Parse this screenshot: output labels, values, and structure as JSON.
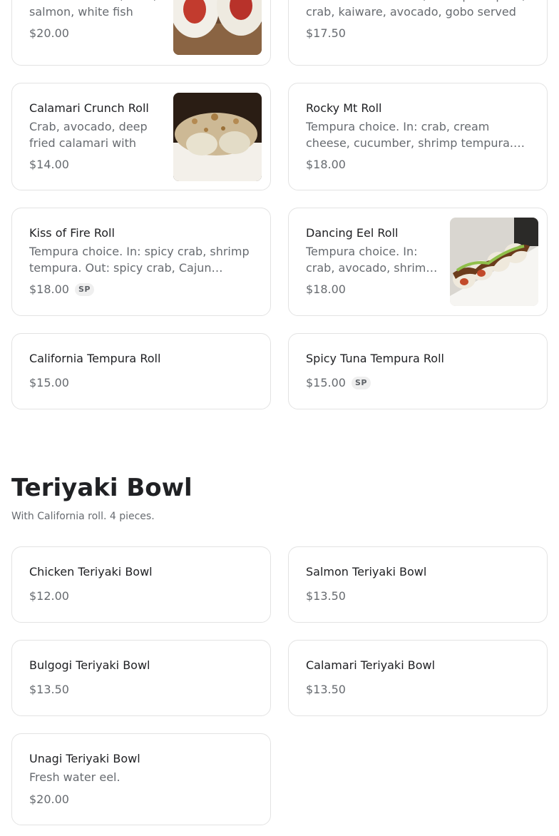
{
  "sushi_rolls": {
    "items": [
      {
        "name": "",
        "desc": "No rice. In: crab, tuna, salmon, white fish",
        "price": "$20.00",
        "image": "sushi-roll-photo"
      },
      {
        "name": "",
        "desc": "No rice. Seared tuna, shrimp tempura, crab, kaiware, avocado, gobo served",
        "price": "$17.50"
      },
      {
        "name": "Calamari Crunch Roll",
        "desc": "Crab, avocado, deep fried calamari with",
        "price": "$14.00",
        "image": "calamari-crunch-photo"
      },
      {
        "name": "Rocky Mt Roll",
        "desc": "Tempura choice. In: crab, cream cheese, cucumber, shrimp tempura. Out:",
        "price": "$18.00"
      },
      {
        "name": "Kiss of Fire Roll",
        "desc": "Tempura choice. In: spicy crab, shrimp tempura. Out: spicy crab, Cajun seasoning",
        "price": "$18.00",
        "badge": "SP"
      },
      {
        "name": "Dancing Eel Roll",
        "desc": "Tempura choice. In: crab, avocado, shrimp tempura",
        "price": "$18.00",
        "image": "dancing-eel-photo"
      },
      {
        "name": "California Tempura Roll",
        "price": "$15.00"
      },
      {
        "name": "Spicy Tuna Tempura Roll",
        "price": "$15.00",
        "badge": "SP"
      }
    ]
  },
  "teriyaki_bowl": {
    "title": "Teriyaki Bowl",
    "subtitle": "With California roll. 4 pieces.",
    "items": [
      {
        "name": "Chicken Teriyaki Bowl",
        "price": "$12.00"
      },
      {
        "name": "Salmon Teriyaki Bowl",
        "price": "$13.50"
      },
      {
        "name": "Bulgogi Teriyaki Bowl",
        "price": "$13.50"
      },
      {
        "name": "Calamari Teriyaki Bowl",
        "price": "$13.50"
      },
      {
        "name": "Unagi Teriyaki Bowl",
        "desc": "Fresh water eel.",
        "price": "$20.00"
      }
    ]
  }
}
